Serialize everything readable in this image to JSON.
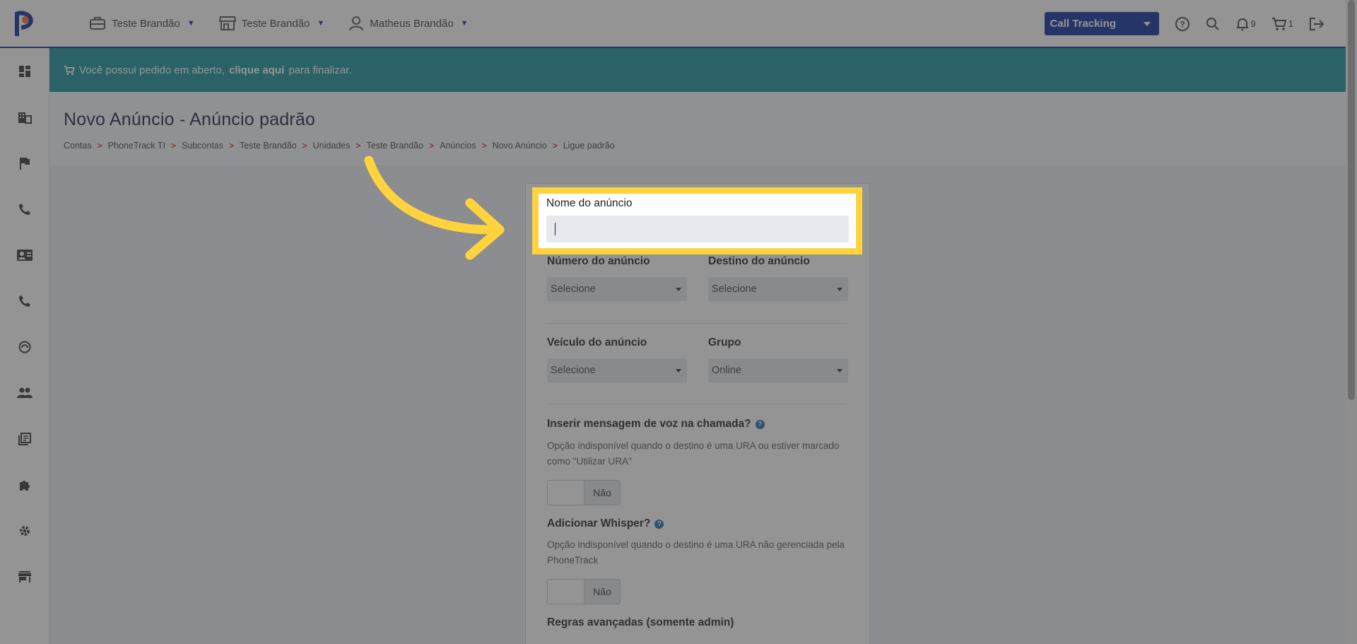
{
  "topbar": {
    "menu": [
      {
        "label": "Teste Brandão",
        "icon": "briefcase-icon"
      },
      {
        "label": "Teste Brandão",
        "icon": "store-icon"
      },
      {
        "label": "Matheus Brandão",
        "icon": "user-icon"
      }
    ],
    "product_select": "Call Tracking",
    "notifications_count": "9",
    "cart_count": "1"
  },
  "sidebar": {
    "items": [
      "dashboard-icon",
      "building-icon",
      "flag-icon",
      "phone-icon",
      "contact-card-icon",
      "phone-icon",
      "speed-icon",
      "people-icon",
      "library-icon",
      "puzzle-icon",
      "gear-icon",
      "store-icon"
    ]
  },
  "banner": {
    "prefix": "Você possui pedido em aberto,",
    "link": "clique aqui",
    "suffix": "para finalizar."
  },
  "page": {
    "title": "Novo Anúncio - Anúncio padrão",
    "breadcrumb": [
      "Contas",
      "PhoneTrack TI",
      "Subcontas",
      "Teste Brandão",
      "Unidades",
      "Teste Brandão",
      "Anúncios",
      "Novo Anúncio",
      "Ligue padrão"
    ]
  },
  "form": {
    "name_label": "Nome do anúncio",
    "name_value": "",
    "numero_label": "Número do anúncio",
    "numero_value": "Selecione",
    "destino_label": "Destino do anúncio",
    "destino_value": "Selecione",
    "veiculo_label": "Veículo do anúncio",
    "veiculo_value": "Selecione",
    "grupo_label": "Grupo",
    "grupo_value": "Online",
    "voz_label": "Inserir mensagem de voz na chamada?",
    "voz_note": "Opção indisponível quando o destino é uma URA ou estiver marcado como \"Utilizar URA\"",
    "voz_toggle": "Não",
    "whisper_label": "Adicionar Whisper?",
    "whisper_note": "Opção indisponível quando o destino é uma URA não gerenciada pela PhoneTrack",
    "whisper_toggle": "Não",
    "regras_label": "Regras avançadas (somente admin)"
  },
  "colors": {
    "brand": "#0d2d9c",
    "banner": "#15919e",
    "highlight": "#ffd33d",
    "breadcrumb_sep": "#d9382c"
  }
}
